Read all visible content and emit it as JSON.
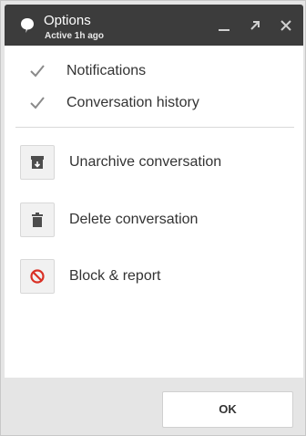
{
  "header": {
    "title": "Options",
    "subtitle": "Active 1h ago",
    "icons": [
      "chat-bubble-icon",
      "minimize-icon",
      "popout-icon",
      "close-icon"
    ],
    "background": "#3c3c3c"
  },
  "options": [
    {
      "label": "Notifications",
      "checked": true,
      "icon": "checkmark-icon"
    },
    {
      "label": "Conversation history",
      "checked": true,
      "icon": "checkmark-icon"
    }
  ],
  "actions": [
    {
      "label": "Unarchive conversation",
      "icon": "unarchive-icon"
    },
    {
      "label": "Delete conversation",
      "icon": "trash-icon"
    },
    {
      "label": "Block & report",
      "icon": "block-icon"
    }
  ],
  "footer": {
    "ok_label": "OK"
  },
  "colors": {
    "block_icon": "#d93025",
    "icon_gray": "#4d4d4d"
  }
}
